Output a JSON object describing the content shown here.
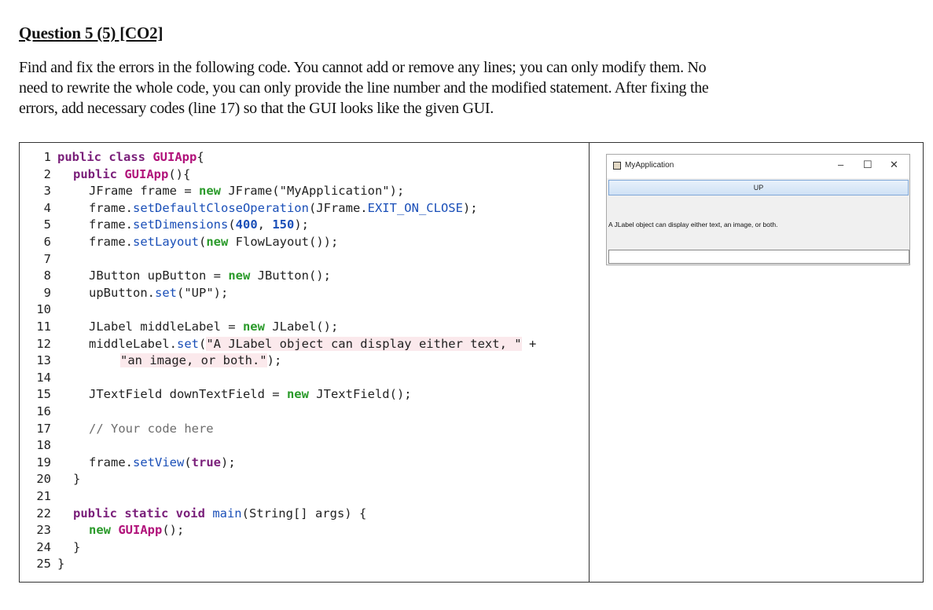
{
  "heading": "Question 5 (5) [CO2]",
  "intro_lines": [
    "Find and fix the errors in the following code. You cannot add or remove any lines; you can only modify them. No",
    "need to rewrite the whole code, you can only provide the line number and the modified statement. After fixing the",
    "errors, add necessary codes (line 17) so that the GUI looks like the given GUI."
  ],
  "code": [
    {
      "n": "1",
      "indent": 0,
      "parts": [
        [
          "kw",
          "public class "
        ],
        [
          "cls",
          "GUIApp"
        ],
        [
          "",
          "{"
        ]
      ]
    },
    {
      "n": "2",
      "indent": 1,
      "parts": [
        [
          "kw",
          "public "
        ],
        [
          "cls",
          "GUIApp"
        ],
        [
          "",
          "(){"
        ]
      ]
    },
    {
      "n": "3",
      "indent": 2,
      "parts": [
        [
          "",
          "JFrame frame = "
        ],
        [
          "hl",
          "new "
        ],
        [
          "",
          "JFrame(\"MyApplication\");"
        ]
      ]
    },
    {
      "n": "4",
      "indent": 2,
      "parts": [
        [
          "",
          "frame."
        ],
        [
          "mth",
          "setDefaultCloseOperation"
        ],
        [
          "",
          "(JFrame."
        ],
        [
          "mth",
          "EXIT_ON_CLOSE"
        ],
        [
          "",
          ");"
        ]
      ]
    },
    {
      "n": "5",
      "indent": 2,
      "parts": [
        [
          "",
          "frame."
        ],
        [
          "mth",
          "setDimensions"
        ],
        [
          "",
          "("
        ],
        [
          "num",
          "400"
        ],
        [
          "",
          ", "
        ],
        [
          "num",
          "150"
        ],
        [
          "",
          ");"
        ]
      ]
    },
    {
      "n": "6",
      "indent": 2,
      "parts": [
        [
          "",
          "frame."
        ],
        [
          "mth",
          "setLayout"
        ],
        [
          "",
          "("
        ],
        [
          "hl",
          "new "
        ],
        [
          "",
          "FlowLayout());"
        ]
      ]
    },
    {
      "n": "7",
      "indent": 0,
      "parts": []
    },
    {
      "n": "8",
      "indent": 2,
      "parts": [
        [
          "",
          "JButton upButton = "
        ],
        [
          "hl",
          "new "
        ],
        [
          "",
          "JButton();"
        ]
      ]
    },
    {
      "n": "9",
      "indent": 2,
      "parts": [
        [
          "",
          "upButton."
        ],
        [
          "mth",
          "set"
        ],
        [
          "",
          "(\"UP\");"
        ]
      ]
    },
    {
      "n": "10",
      "indent": 0,
      "parts": []
    },
    {
      "n": "11",
      "indent": 2,
      "parts": [
        [
          "",
          "JLabel middleLabel = "
        ],
        [
          "hl",
          "new "
        ],
        [
          "",
          "JLabel();"
        ]
      ]
    },
    {
      "n": "12",
      "indent": 2,
      "parts": [
        [
          "",
          "middleLabel."
        ],
        [
          "mth",
          "set"
        ],
        [
          "",
          "("
        ],
        [
          "pink",
          "\"A JLabel object can display either text, \""
        ],
        [
          "",
          " +"
        ]
      ]
    },
    {
      "n": "13",
      "indent": 4,
      "parts": [
        [
          "pink",
          "\"an image, or both.\""
        ],
        [
          "",
          ");"
        ]
      ]
    },
    {
      "n": "14",
      "indent": 0,
      "parts": []
    },
    {
      "n": "15",
      "indent": 2,
      "parts": [
        [
          "",
          "JTextField downTextField = "
        ],
        [
          "hl",
          "new "
        ],
        [
          "",
          "JTextField();"
        ]
      ]
    },
    {
      "n": "16",
      "indent": 0,
      "parts": []
    },
    {
      "n": "17",
      "indent": 2,
      "parts": [
        [
          "cmt",
          "// Your code here"
        ]
      ]
    },
    {
      "n": "18",
      "indent": 0,
      "parts": []
    },
    {
      "n": "19",
      "indent": 2,
      "parts": [
        [
          "",
          "frame."
        ],
        [
          "mth",
          "setView"
        ],
        [
          "",
          "("
        ],
        [
          "kw",
          "true"
        ],
        [
          "",
          ");"
        ]
      ]
    },
    {
      "n": "20",
      "indent": 1,
      "parts": [
        [
          "",
          "}"
        ]
      ]
    },
    {
      "n": "21",
      "indent": 0,
      "parts": []
    },
    {
      "n": "22",
      "indent": 1,
      "parts": [
        [
          "kw",
          "public static void "
        ],
        [
          "mth",
          "main"
        ],
        [
          "",
          "(String[] args) {"
        ]
      ]
    },
    {
      "n": "23",
      "indent": 2,
      "parts": [
        [
          "hl",
          "new "
        ],
        [
          "cls",
          "GUIApp"
        ],
        [
          "",
          "();"
        ]
      ]
    },
    {
      "n": "24",
      "indent": 1,
      "parts": [
        [
          "",
          "}"
        ]
      ]
    },
    {
      "n": "25",
      "indent": 0,
      "parts": [
        [
          "",
          "}"
        ]
      ]
    }
  ],
  "gui": {
    "window_title": "MyApplication",
    "minimize_glyph": "–",
    "maximize_glyph": "☐",
    "close_glyph": "✕",
    "up_button": "UP",
    "middle_label": "A JLabel object can display either text, an image, or both.",
    "down_field_value": ""
  }
}
